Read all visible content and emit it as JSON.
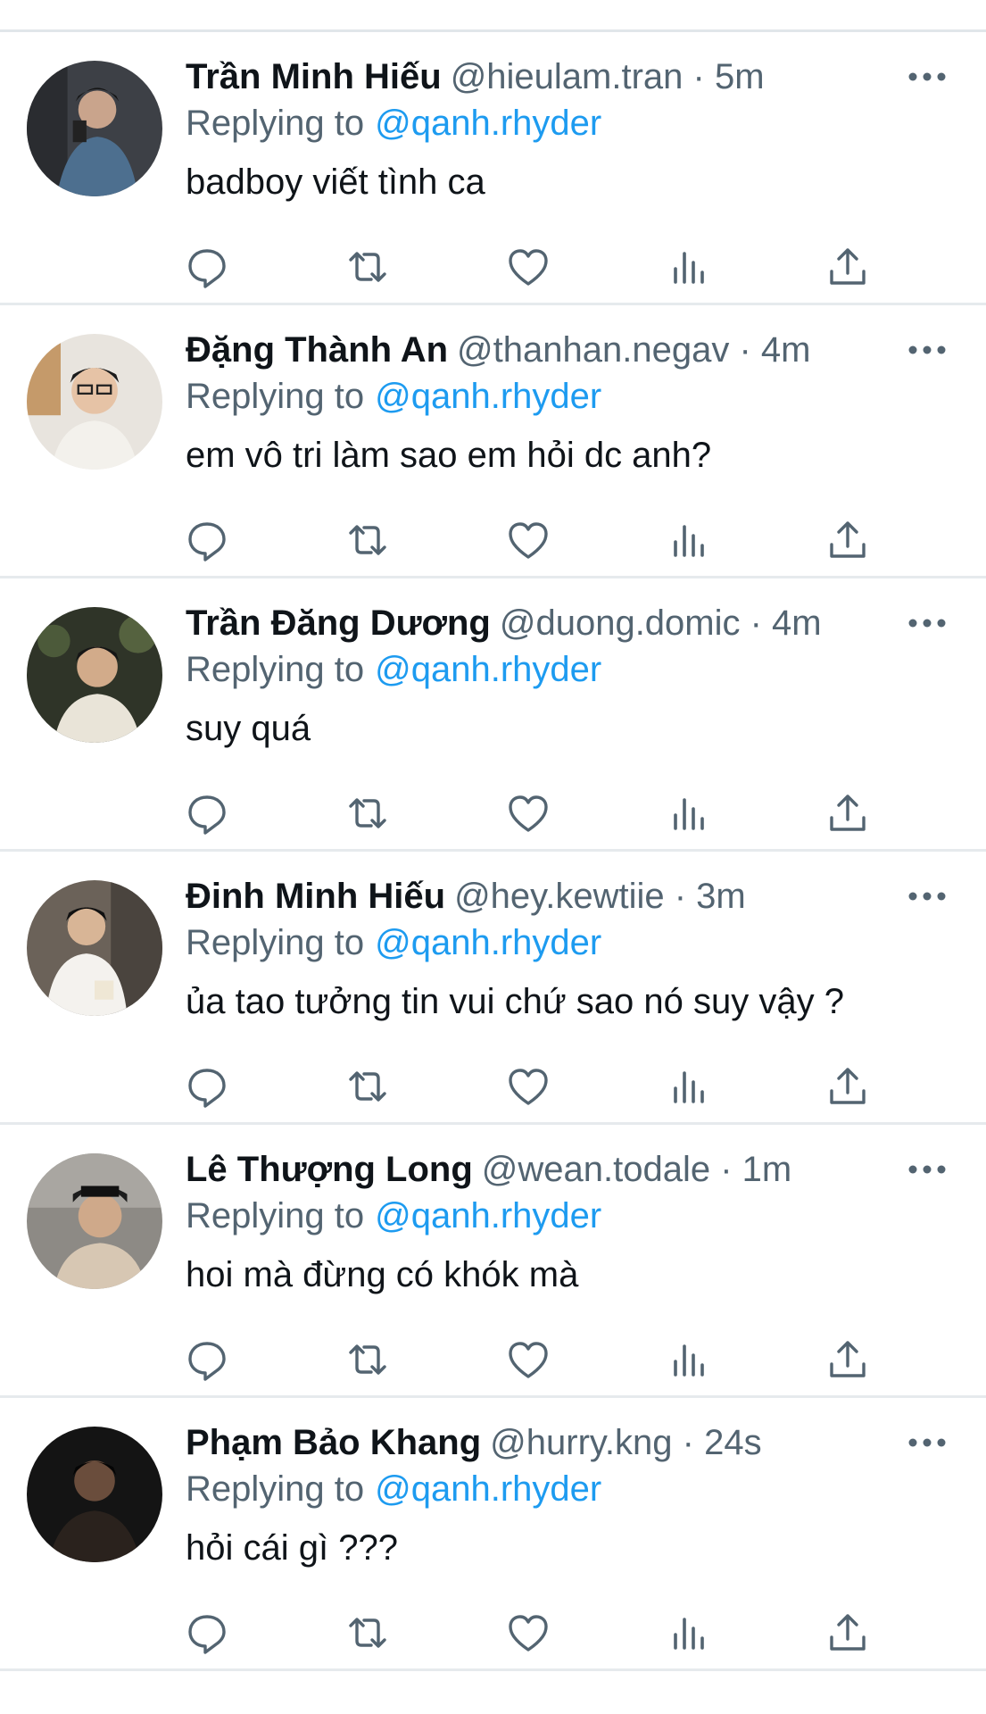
{
  "tweets": [
    {
      "display_name": "Trần Minh Hiếu",
      "handle_time": "@hieulam.tran · 5m",
      "replying_prefix": "Replying to",
      "replying_to": "@qanh.rhyder",
      "text": "badboy viết tình ca"
    },
    {
      "display_name": "Đặng Thành An",
      "handle_time": "@thanhan.negav · 4m",
      "replying_prefix": "Replying to",
      "replying_to": "@qanh.rhyder",
      "text": "em vô tri làm sao em hỏi dc anh?"
    },
    {
      "display_name": "Trần Đăng Dương",
      "handle_time": "@duong.domic · 4m",
      "replying_prefix": "Replying to",
      "replying_to": "@qanh.rhyder",
      "text": "suy quá"
    },
    {
      "display_name": "Đinh Minh Hiếu",
      "handle_time": "@hey.kewtiie · 3m",
      "replying_prefix": "Replying to",
      "replying_to": "@qanh.rhyder",
      "text": "ủa tao tưởng tin vui chứ sao nó suy vậy ?"
    },
    {
      "display_name": "Lê Thượng Long",
      "handle_time": "@wean.todale · 1m",
      "replying_prefix": "Replying to",
      "replying_to": "@qanh.rhyder",
      "text": "hoi mà đừng có khók mà"
    },
    {
      "display_name": "Phạm Bảo Khang",
      "handle_time": "@hurry.kng · 24s",
      "replying_prefix": "Replying to",
      "replying_to": "@qanh.rhyder",
      "text": "hỏi cái gì ???"
    }
  ],
  "icons": {
    "reply": "reply-icon",
    "retweet": "retweet-icon",
    "like": "like-icon",
    "views": "views-icon",
    "share": "share-icon",
    "more": "more-icon"
  },
  "colors": {
    "text": "#0f1419",
    "secondary": "#536471",
    "link": "#1d9bf0",
    "divider": "#e6eaed"
  }
}
